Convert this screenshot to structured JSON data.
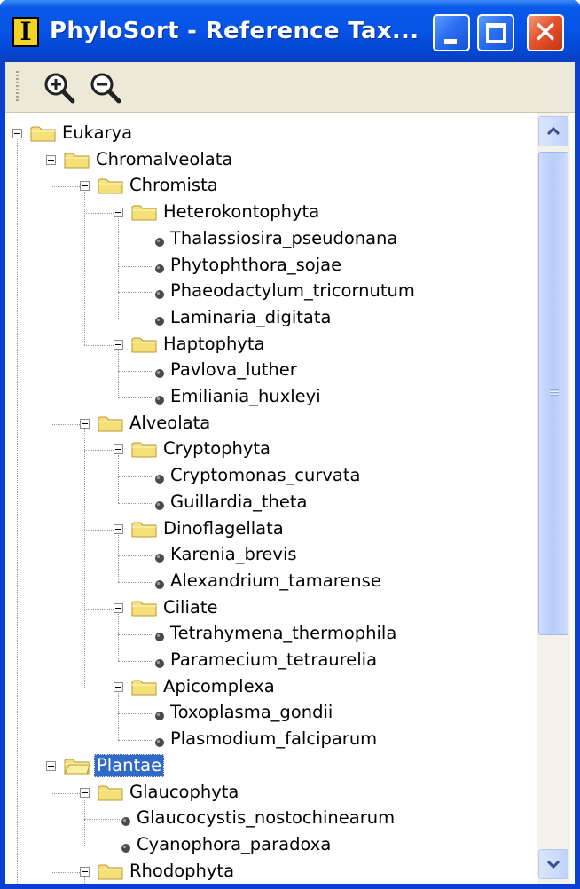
{
  "window": {
    "title": "PhyloSort - Reference Tax...",
    "app_icon_letter": "I",
    "controls": {
      "minimize": "minimize-icon",
      "maximize": "maximize-icon",
      "close": "close-icon"
    }
  },
  "toolbar": {
    "zoom_in_icon": "zoom-in-icon",
    "zoom_out_icon": "zoom-out-icon"
  },
  "colors": {
    "titlebar": "#0653e6",
    "selection": "#316ac5",
    "folder": "#f5e07a",
    "close_button": "#e4542c"
  },
  "tree": {
    "nodes": [
      {
        "label": "Eukarya",
        "kind": "folder"
      },
      {
        "label": "Chromalveolata",
        "kind": "folder"
      },
      {
        "label": "Chromista",
        "kind": "folder"
      },
      {
        "label": "Heterokontophyta",
        "kind": "folder"
      },
      {
        "label": "Thalassiosira_pseudonana",
        "kind": "leaf"
      },
      {
        "label": "Phytophthora_sojae",
        "kind": "leaf"
      },
      {
        "label": "Phaeodactylum_tricornutum",
        "kind": "leaf"
      },
      {
        "label": "Laminaria_digitata",
        "kind": "leaf"
      },
      {
        "label": "Haptophyta",
        "kind": "folder"
      },
      {
        "label": "Pavlova_luther",
        "kind": "leaf"
      },
      {
        "label": "Emiliania_huxleyi",
        "kind": "leaf"
      },
      {
        "label": "Alveolata",
        "kind": "folder"
      },
      {
        "label": "Cryptophyta",
        "kind": "folder"
      },
      {
        "label": "Cryptomonas_curvata",
        "kind": "leaf"
      },
      {
        "label": "Guillardia_theta",
        "kind": "leaf"
      },
      {
        "label": "Dinoflagellata",
        "kind": "folder"
      },
      {
        "label": "Karenia_brevis",
        "kind": "leaf"
      },
      {
        "label": "Alexandrium_tamarense",
        "kind": "leaf"
      },
      {
        "label": "Ciliate",
        "kind": "folder"
      },
      {
        "label": "Tetrahymena_thermophila",
        "kind": "leaf"
      },
      {
        "label": "Paramecium_tetraurelia",
        "kind": "leaf"
      },
      {
        "label": "Apicomplexa",
        "kind": "folder"
      },
      {
        "label": "Toxoplasma_gondii",
        "kind": "leaf"
      },
      {
        "label": "Plasmodium_falciparum",
        "kind": "leaf"
      },
      {
        "label": "Plantae",
        "kind": "folder",
        "selected": true
      },
      {
        "label": "Glaucophyta",
        "kind": "folder"
      },
      {
        "label": "Glaucocystis_nostochinearum",
        "kind": "leaf"
      },
      {
        "label": "Cyanophora_paradoxa",
        "kind": "leaf"
      },
      {
        "label": "Rhodophyta",
        "kind": "folder"
      }
    ]
  }
}
